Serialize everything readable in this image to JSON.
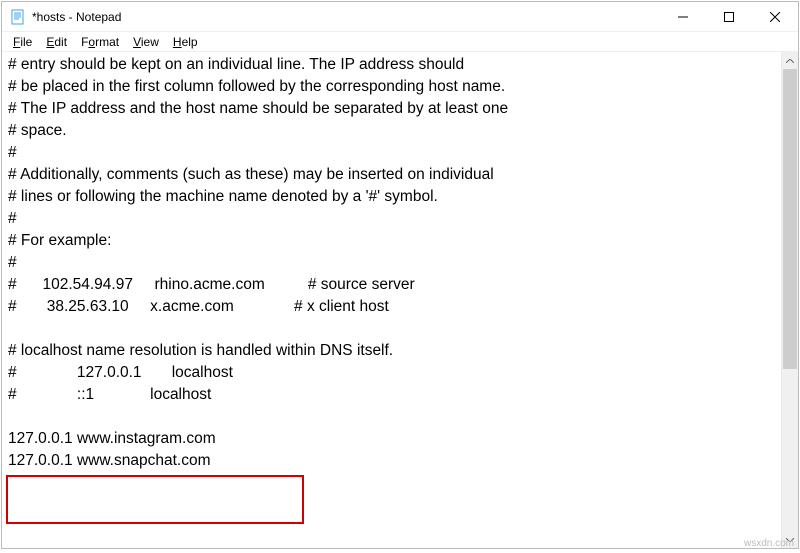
{
  "window": {
    "title": "*hosts - Notepad"
  },
  "menu": {
    "file": "File",
    "edit": "Edit",
    "format": "Format",
    "view": "View",
    "help": "Help"
  },
  "editor": {
    "content": "# entry should be kept on an individual line. The IP address should\n# be placed in the first column followed by the corresponding host name.\n# The IP address and the host name should be separated by at least one\n# space.\n#\n# Additionally, comments (such as these) may be inserted on individual\n# lines or following the machine name denoted by a '#' symbol.\n#\n# For example:\n#\n#      102.54.94.97     rhino.acme.com          # source server\n#       38.25.63.10     x.acme.com              # x client host\n\n# localhost name resolution is handled within DNS itself.\n#              127.0.0.1       localhost\n#              ::1             localhost\n\n127.0.0.1 www.instagram.com\n127.0.0.1 www.snapchat.com"
  },
  "watermark": "wsxdn.com"
}
